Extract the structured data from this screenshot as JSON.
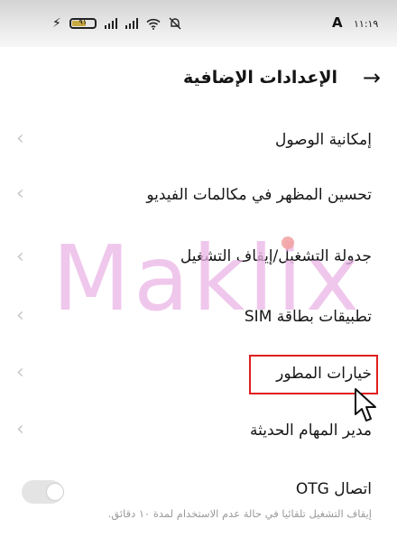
{
  "status_bar": {
    "time": "١١:١٩",
    "network_indicator": "A",
    "battery_percent": "٩١",
    "icons": [
      "bolt-icon",
      "battery-icon",
      "signal-icon",
      "signal-icon",
      "wifi-icon",
      "mute-icon"
    ]
  },
  "header": {
    "title": "الإعدادات الإضافية",
    "back_icon": "arrow-right-icon"
  },
  "settings": {
    "items": [
      {
        "label": "إمكانية الوصول"
      },
      {
        "label": "تحسين المظهر في مكالمات الفيديو"
      },
      {
        "label": "جدولة التشغيل/إيقاف التشغيل"
      },
      {
        "label": "تطبيقات بطاقة SIM"
      },
      {
        "label": "خيارات المطور"
      },
      {
        "label": "مدير المهام الحديثة"
      }
    ],
    "otg": {
      "label": "اتصال OTG",
      "description": "إيقاف التشغيل تلقائيا في حالة عدم الاستخدام لمدة ١٠ دقائق.",
      "enabled": false
    }
  },
  "highlight": {
    "target": "خيارات المطور",
    "color": "#e01e1e"
  },
  "watermark": {
    "text": "Maklix",
    "color": "#ecb5e6"
  }
}
